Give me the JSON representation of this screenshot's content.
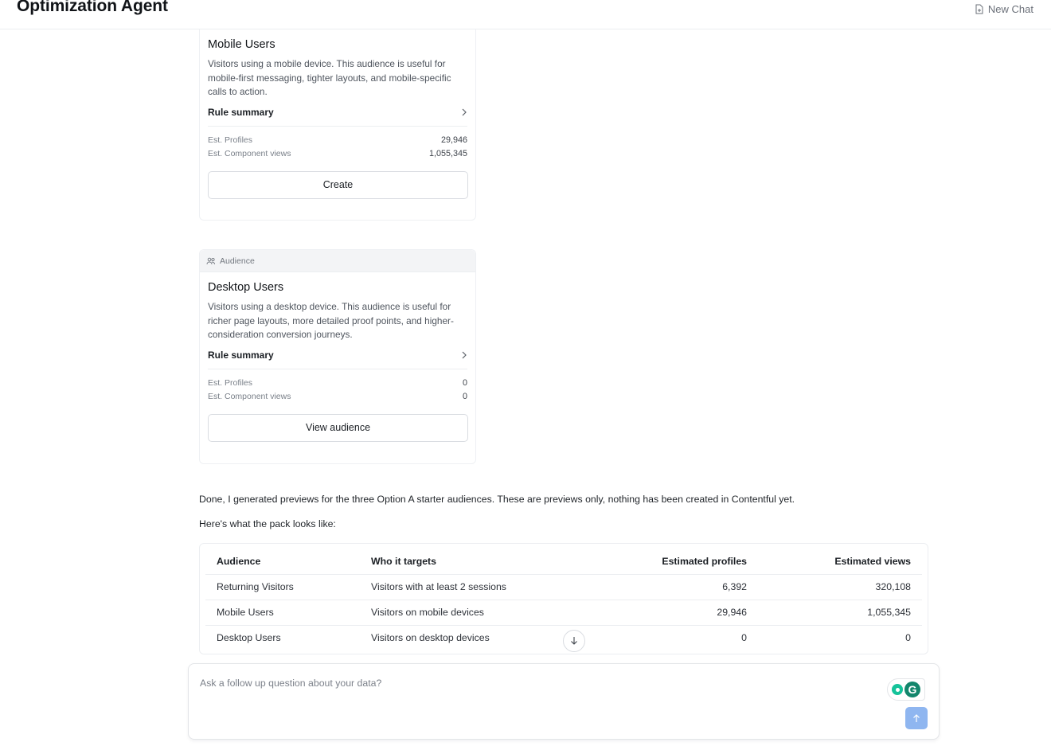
{
  "header": {
    "app_title": "Optimization Agent",
    "new_chat_label": "New Chat"
  },
  "cards": [
    {
      "tag": "",
      "title": "Mobile Users",
      "description": "Visitors using a mobile device. This audience is useful for mobile-first messaging, tighter layouts, and mobile-specific calls to action.",
      "rule_summary_label": "Rule summary",
      "stats": [
        {
          "label": "Est. Profiles",
          "value": "29,946"
        },
        {
          "label": "Est. Component views",
          "value": "1,055,345"
        }
      ],
      "button_label": "Create"
    },
    {
      "tag": "Audience",
      "title": "Desktop Users",
      "description": "Visitors using a desktop device. This audience is useful for richer page layouts, more detailed proof points, and higher-consideration conversion journeys.",
      "rule_summary_label": "Rule summary",
      "stats": [
        {
          "label": "Est. Profiles",
          "value": "0"
        },
        {
          "label": "Est. Component views",
          "value": "0"
        }
      ],
      "button_label": "View audience"
    }
  ],
  "message": {
    "line1": "Done, I generated previews for the three Option A starter audiences. These are previews only, nothing has been created in Contentful yet.",
    "line2": "Here's what the pack looks like:"
  },
  "table": {
    "headers": [
      "Audience",
      "Who it targets",
      "Estimated profiles",
      "Estimated views"
    ],
    "rows": [
      [
        "Returning Visitors",
        "Visitors with at least 2 sessions",
        "6,392",
        "320,108"
      ],
      [
        "Mobile Users",
        "Visitors on mobile devices",
        "29,946",
        "1,055,345"
      ],
      [
        "Desktop Users",
        "Visitors on desktop devices",
        "0",
        "0"
      ]
    ]
  },
  "composer": {
    "placeholder": "Ask a follow up question about your data?",
    "value": "",
    "grammarly_letter": "G"
  },
  "icons": {
    "new_chat": "new-document-icon",
    "audience": "people-icon",
    "rule_summary": "chevron-right-icon",
    "scroll_down": "arrow-down-icon",
    "send": "arrow-up-icon"
  },
  "colors": {
    "send_button": "#8fb6f0",
    "grammarly_green": "#13866c",
    "grammarly_bulb": "#15c39a"
  }
}
